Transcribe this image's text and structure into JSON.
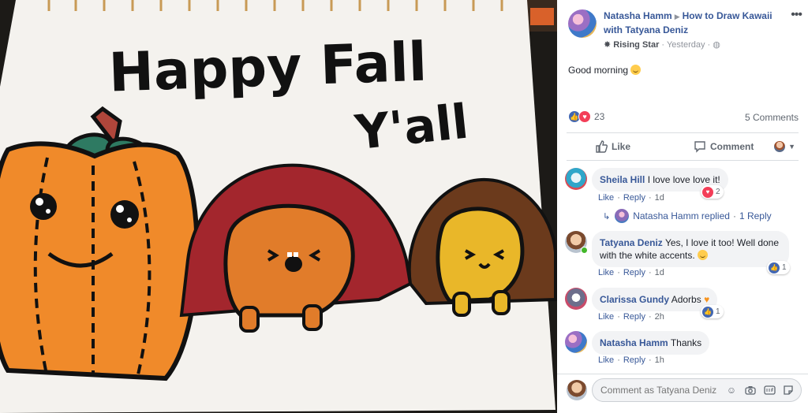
{
  "photo": {
    "title_line1": "Happy Fall",
    "title_line2": "Y'all",
    "colors": {
      "pumpkin": "#f08a2a",
      "hedgehog_red": "#a3262d",
      "hedgehog_brown": "#6b3a1c",
      "hedgehog_yellow": "#e9b729"
    }
  },
  "post": {
    "author": "Natasha Hamm",
    "group": "How to Draw Kawaii with Tatyana Deniz",
    "badge": "Rising Star",
    "time": "Yesterday",
    "text": "Good morning",
    "reaction_count": "23",
    "comments_count": "5 Comments"
  },
  "actions": {
    "like": "Like",
    "comment": "Comment"
  },
  "comments": [
    {
      "name": "Sheila Hill",
      "text": "I love love love it!",
      "like": "Like",
      "reply": "Reply",
      "time": "1d",
      "reaction_count": "2"
    },
    {
      "name": "Tatyana Deniz",
      "text_line1": "Yes, I love it too! Well done",
      "text_line2": "with the white accents.",
      "like": "Like",
      "reply": "Reply",
      "time": "1d",
      "reaction_count": "1"
    },
    {
      "name": "Clarissa Gundy",
      "text": "Adorbs",
      "like": "Like",
      "reply": "Reply",
      "time": "2h",
      "reaction_count": "1"
    },
    {
      "name": "Natasha Hamm",
      "text": "Thanks",
      "like": "Like",
      "reply": "Reply",
      "time": "1h"
    }
  ],
  "reply_summary": {
    "who": "Natasha Hamm replied",
    "count": "1 Reply"
  },
  "composer": {
    "placeholder": "Comment as Tatyana Deniz"
  }
}
